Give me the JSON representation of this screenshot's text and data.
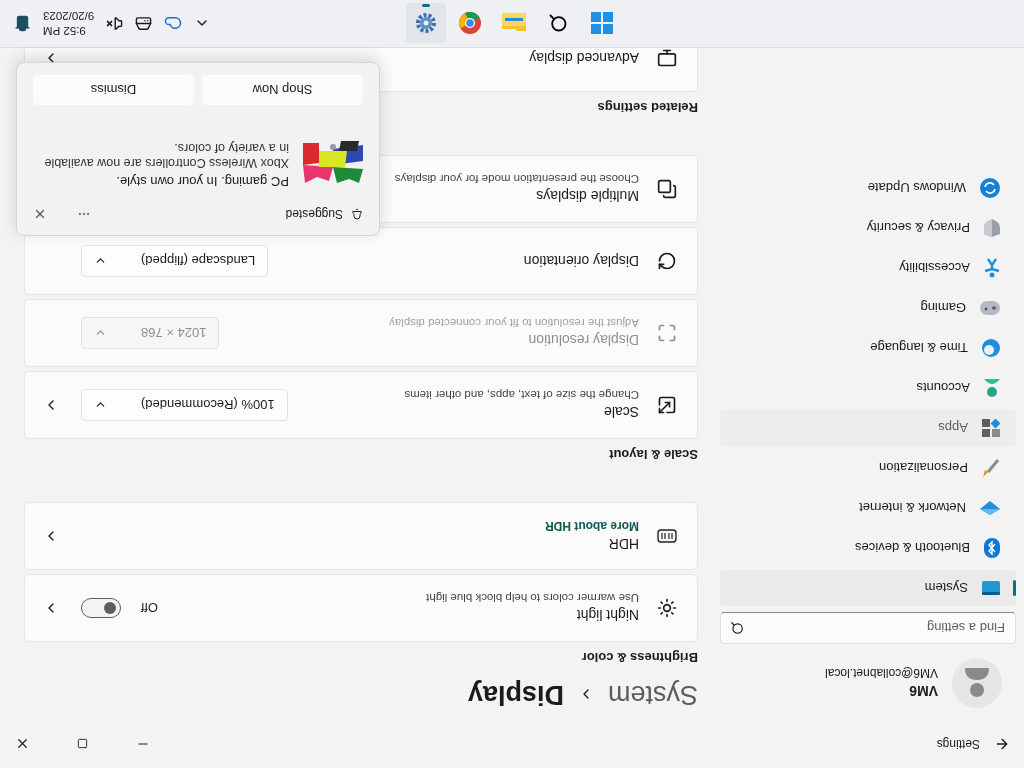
{
  "window": {
    "title": "Settings"
  },
  "user": {
    "name": "VM6",
    "email": "VM6@collabnet.local"
  },
  "search": {
    "placeholder": "Find a setting"
  },
  "nav": [
    {
      "label": "System",
      "selected": true,
      "hovered": false
    },
    {
      "label": "Bluetooth & devices",
      "selected": false,
      "hovered": false
    },
    {
      "label": "Network & internet",
      "selected": false,
      "hovered": false
    },
    {
      "label": "Personalization",
      "selected": false,
      "hovered": false
    },
    {
      "label": "Apps",
      "selected": false,
      "hovered": true
    },
    {
      "label": "Accounts",
      "selected": false,
      "hovered": false
    },
    {
      "label": "Time & language",
      "selected": false,
      "hovered": false
    },
    {
      "label": "Gaming",
      "selected": false,
      "hovered": false
    },
    {
      "label": "Accessibility",
      "selected": false,
      "hovered": false
    },
    {
      "label": "Privacy & security",
      "selected": false,
      "hovered": false
    },
    {
      "label": "Windows Update",
      "selected": false,
      "hovered": false
    }
  ],
  "breadcrumb": {
    "parent": "System",
    "current": "Display"
  },
  "sections": [
    {
      "heading": "Brightness & color",
      "rows": [
        {
          "kind": "toggle",
          "title": "Night light",
          "description": "Use warmer colors to help block blue light",
          "on": false,
          "state_label": "Off",
          "chevron": true,
          "disabled": false
        },
        {
          "kind": "link",
          "title": "HDR",
          "link": "More about HDR",
          "chevron": true,
          "disabled": false
        }
      ]
    },
    {
      "heading": "Scale & layout",
      "rows": [
        {
          "kind": "dropdown",
          "title": "Scale",
          "description": "Change the size of text, apps, and other items",
          "value": "100% (Recommended)",
          "chevron": true,
          "disabled": false
        },
        {
          "kind": "dropdown",
          "title": "Display resolution",
          "description": "Adjust the resolution to fit your connected display",
          "value": "1024 × 768",
          "chevron": false,
          "disabled": true
        },
        {
          "kind": "dropdown",
          "title": "Display orientation",
          "value": "Landscape (flipped)",
          "chevron": false,
          "disabled": false
        },
        {
          "kind": "plain",
          "title": "Multiple displays",
          "description": "Choose the presentation mode for your displays",
          "disabled": false
        }
      ]
    },
    {
      "heading": "Related settings",
      "rows": [
        {
          "kind": "plain",
          "title": "Advanced display",
          "chevron": true,
          "disabled": false
        }
      ]
    }
  ],
  "notification": {
    "source": "Suggested",
    "title": "PC gaming. In your own style.",
    "body": "Xbox Wireless Controllers are now available in a variety of colors.",
    "buttons": [
      "Shop Now",
      "Dismiss"
    ]
  },
  "taskbar": {
    "apps": [
      {
        "active": false
      },
      {
        "active": false
      },
      {
        "active": false
      },
      {
        "active": false
      },
      {
        "active": true
      }
    ],
    "time": "9:52 PM",
    "date": "9/20/2023"
  }
}
